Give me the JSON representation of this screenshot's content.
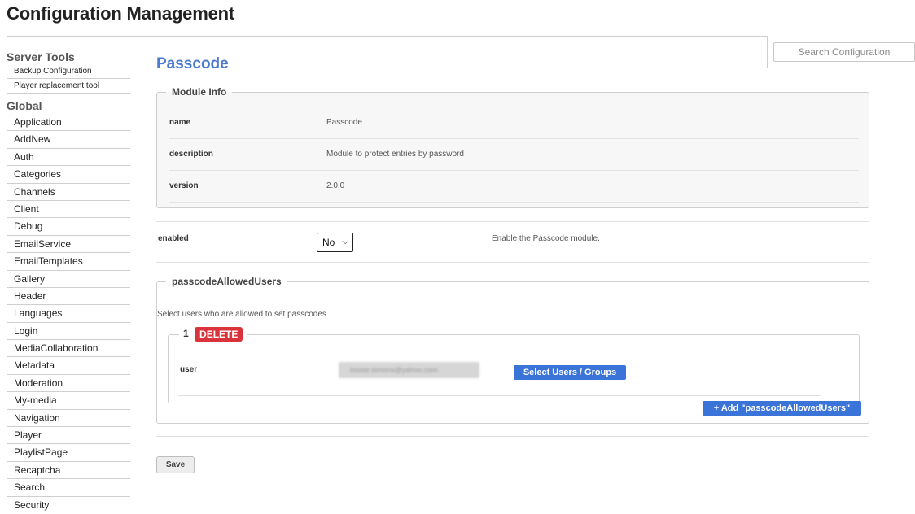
{
  "header": {
    "title": "Configuration Management"
  },
  "search": {
    "placeholder": "Search Configuration"
  },
  "sidebar": {
    "server_tools_heading": "Server Tools",
    "server_tools": [
      "Backup Configuration",
      "Player replacement tool"
    ],
    "global_heading": "Global",
    "global_items": [
      "Application",
      "AddNew",
      "Auth",
      "Categories",
      "Channels",
      "Client",
      "Debug",
      "EmailService",
      "EmailTemplates",
      "Gallery",
      "Header",
      "Languages",
      "Login",
      "MediaCollaboration",
      "Metadata",
      "Moderation",
      "My-media",
      "Navigation",
      "Player",
      "PlaylistPage",
      "Recaptcha",
      "Search",
      "Security"
    ]
  },
  "main": {
    "title": "Passcode",
    "module_info": {
      "legend": "Module Info",
      "rows": [
        {
          "key": "name",
          "value": "Passcode"
        },
        {
          "key": "description",
          "value": "Module to protect entries by password"
        },
        {
          "key": "version",
          "value": "2.0.0"
        }
      ]
    },
    "enabled": {
      "label": "enabled",
      "selected": "No",
      "description": "Enable the Passcode module."
    },
    "allowed_users": {
      "legend": "passcodeAllowedUsers",
      "description": "Select users who are allowed to set passcodes",
      "entries": [
        {
          "number": "1",
          "delete_label": "DELETE",
          "user_label": "user",
          "user_value": "louise.simons@yahoo.com",
          "select_label": "Select Users / Groups"
        }
      ],
      "add_label": "+ Add \"passcodeAllowedUsers\""
    },
    "save_label": "Save"
  }
}
